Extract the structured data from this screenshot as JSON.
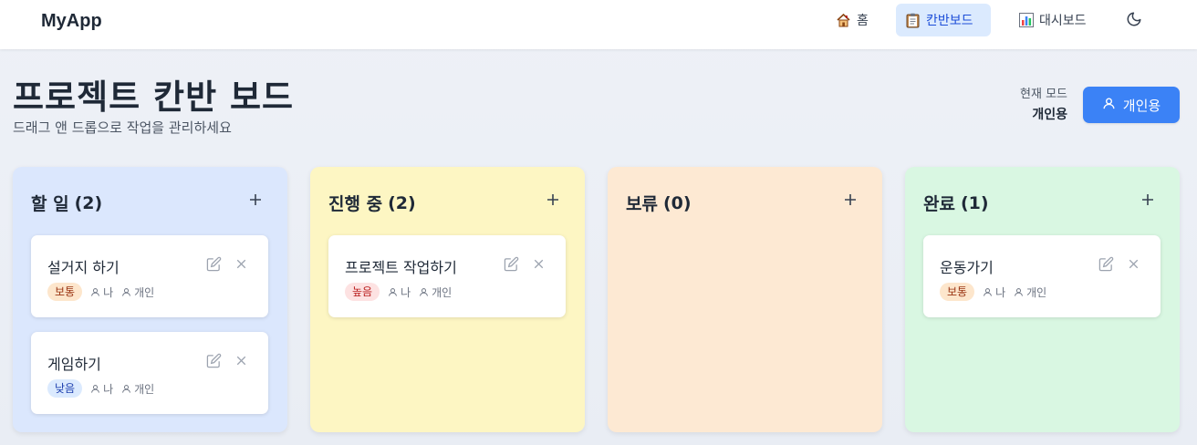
{
  "navbar": {
    "brand": "MyApp",
    "items": [
      {
        "label": "홈",
        "icon": "house-emoji-icon",
        "active": false
      },
      {
        "label": "칸반보드",
        "icon": "clipboard-emoji-icon",
        "active": true
      },
      {
        "label": "대시보드",
        "icon": "bar-chart-emoji-icon",
        "active": false
      }
    ],
    "theme_toggle_icon": "moon-icon"
  },
  "header": {
    "title": "프로젝트 칸반 보드",
    "subtitle": "드래그 앤 드롭으로 작업을 관리하세요",
    "mode_caption": "현재 모드",
    "mode_value": "개인용",
    "mode_button_label": "개인용"
  },
  "columns": [
    {
      "title": "할 일",
      "count": "(2)",
      "color": "#dbe7fd",
      "cards": [
        {
          "title": "설거지 하기",
          "priority": "보통",
          "assignee": "나",
          "scope": "개인"
        },
        {
          "title": "게임하기",
          "priority": "낮음",
          "assignee": "나",
          "scope": "개인"
        }
      ]
    },
    {
      "title": "진행 중",
      "count": "(2)",
      "color": "#fdf6c3",
      "cards": [
        {
          "title": "프로젝트 작업하기",
          "priority": "높음",
          "assignee": "나",
          "scope": "개인"
        }
      ]
    },
    {
      "title": "보류",
      "count": "(0)",
      "color": "#fde9d3",
      "cards": []
    },
    {
      "title": "완료",
      "count": "(1)",
      "color": "#d9f7e2",
      "cards": [
        {
          "title": "운동가기",
          "priority": "보통",
          "assignee": "나",
          "scope": "개인"
        }
      ]
    }
  ],
  "colors": {
    "accent": "#3b82f6",
    "active_nav_bg": "#dbeafe",
    "priority_normal": "#fde6cc",
    "priority_low": "#dbeafe",
    "priority_high": "#fde2e2"
  }
}
